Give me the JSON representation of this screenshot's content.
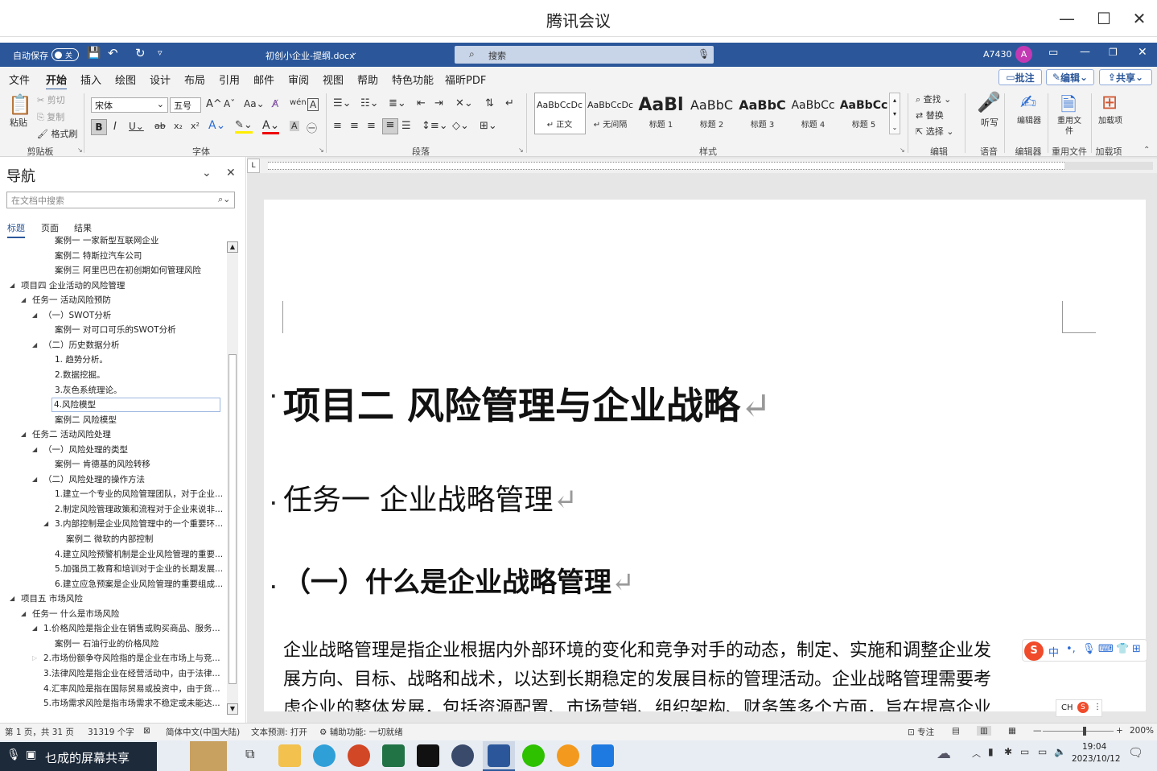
{
  "meeting": {
    "title": "腾讯会议"
  },
  "word": {
    "autosave_label": "自动保存",
    "autosave_state": "关",
    "filename": "初创小企业-提纲.docx",
    "search_placeholder": "搜索",
    "user": "A7430",
    "avatar_letter": "A"
  },
  "menu": {
    "tabs": [
      "文件",
      "开始",
      "插入",
      "绘图",
      "设计",
      "布局",
      "引用",
      "邮件",
      "审阅",
      "视图",
      "帮助",
      "特色功能",
      "福昕PDF"
    ],
    "comment_btn": "批注",
    "edit_btn": "编辑",
    "share_btn": "共享"
  },
  "ribbon": {
    "clipboard": {
      "paste": "粘贴",
      "cut": "剪切",
      "copy": "复制",
      "format_painter": "格式刷",
      "label": "剪贴板"
    },
    "font": {
      "name": "宋体",
      "size": "五号",
      "label": "字体"
    },
    "paragraph": {
      "label": "段落"
    },
    "styles": {
      "label": "样式",
      "items": [
        {
          "preview": "AaBbCcDc",
          "name": "↵ 正文"
        },
        {
          "preview": "AaBbCcDc",
          "name": "↵ 无间隔"
        },
        {
          "preview": "AaBl",
          "name": "标题 1"
        },
        {
          "preview": "AaBbC",
          "name": "标题 2"
        },
        {
          "preview": "AaBbC",
          "name": "标题 3"
        },
        {
          "preview": "AaBbCc",
          "name": "标题 4"
        },
        {
          "preview": "AaBbCc",
          "name": "标题 5"
        }
      ]
    },
    "editing": {
      "find": "查找",
      "replace": "替换",
      "select": "选择",
      "label": "编辑"
    },
    "voice": {
      "dictate": "听写",
      "label": "语音"
    },
    "editor": {
      "btn": "编辑器",
      "label": "编辑器"
    },
    "reuse": {
      "btn": "重用文件",
      "label": "重用文件"
    },
    "addins": {
      "btn": "加载项",
      "label": "加载项"
    }
  },
  "nav": {
    "title": "导航",
    "search_placeholder": "在文档中搜索",
    "tabs": [
      "标题",
      "页面",
      "结果"
    ],
    "items": [
      {
        "text": "案例一 一家新型互联网企业",
        "level": 3
      },
      {
        "text": "案例二 特斯拉汽车公司",
        "level": 3
      },
      {
        "text": "案例三 阿里巴巴在初创期如何管理风险",
        "level": 3
      },
      {
        "text": "项目四 企业活动的风险管理",
        "level": 0
      },
      {
        "text": "任务一 活动风险预防",
        "level": 1
      },
      {
        "text": "（一）SWOT分析",
        "level": 2
      },
      {
        "text": "案例一 对可口可乐的SWOT分析",
        "level": 3
      },
      {
        "text": "（二）历史数据分析",
        "level": 2
      },
      {
        "text": "1. 趋势分析。",
        "level": 3
      },
      {
        "text": "2.数据挖掘。",
        "level": 3
      },
      {
        "text": "3.灰色系统理论。",
        "level": 3
      },
      {
        "text": "4.风险模型",
        "level": 3
      },
      {
        "text": "案例二 风险模型",
        "level": 3
      },
      {
        "text": "任务二 活动风险处理",
        "level": 1
      },
      {
        "text": "（一）风险处理的类型",
        "level": 2
      },
      {
        "text": "案例一 肯德基的风险转移",
        "level": 3
      },
      {
        "text": "（二）风险处理的操作方法",
        "level": 2
      },
      {
        "text": "1.建立一个专业的风险管理团队，对于企业...",
        "level": 3
      },
      {
        "text": "2.制定风险管理政策和流程对于企业来说非...",
        "level": 3
      },
      {
        "text": "3.内部控制是企业风险管理中的一个重要环...",
        "level": 3
      },
      {
        "text": "案例二 微软的内部控制",
        "level": 4
      },
      {
        "text": "4.建立风险预警机制是企业风险管理的重要...",
        "level": 3
      },
      {
        "text": "5.加强员工教育和培训对于企业的长期发展...",
        "level": 3
      },
      {
        "text": "6.建立应急预案是企业风险管理的重要组成...",
        "level": 3
      },
      {
        "text": "项目五 市场风险",
        "level": 0
      },
      {
        "text": "任务一 什么是市场风险",
        "level": 1
      },
      {
        "text": "1.价格风险是指企业在销售或购买商品、服务...",
        "level": 2
      },
      {
        "text": "案例一 石油行业的价格风险",
        "level": 3
      },
      {
        "text": "2.市场份额争夺风险指的是企业在市场上与竞...",
        "level": 2
      },
      {
        "text": "3.法律风险是指企业在经营活动中，由于法律...",
        "level": 2
      },
      {
        "text": "4.汇率风险是指在国际贸易或投资中，由于货...",
        "level": 2
      },
      {
        "text": "5.市场需求风险是指市场需求不稳定或未能达...",
        "level": 2
      }
    ]
  },
  "document": {
    "heading1": "项目二  风险管理与企业战略",
    "heading2": "任务一  企业战略管理",
    "heading3": "（一）什么是企业战略管理",
    "body": [
      "企业战略管理是指企业根据内外部环境的变化和竞争对手的动态，制定、实施和调整企业发",
      "展方向、目标、战略和战术，以达到长期稳定的发展目标的管理活动。企业战略管理需要考",
      "虑企业的整体发展，包括资源配置、市场营销、组织架构、财务等多个方面，旨在提高企业"
    ],
    "pilcrow": "↵"
  },
  "status": {
    "page": "第 1 页，共 31 页",
    "words": "31319 个字",
    "lang": "简体中文(中国大陆)",
    "predict": "文本预测: 打开",
    "access": "辅助功能: 一切就绪",
    "focus": "专注",
    "zoom": "200%"
  },
  "taskbar": {
    "share_text": "乜成的屏幕共享",
    "time": "19:04",
    "date": "2023/10/12",
    "ime_cn": "中",
    "ime_tray": "CH"
  }
}
